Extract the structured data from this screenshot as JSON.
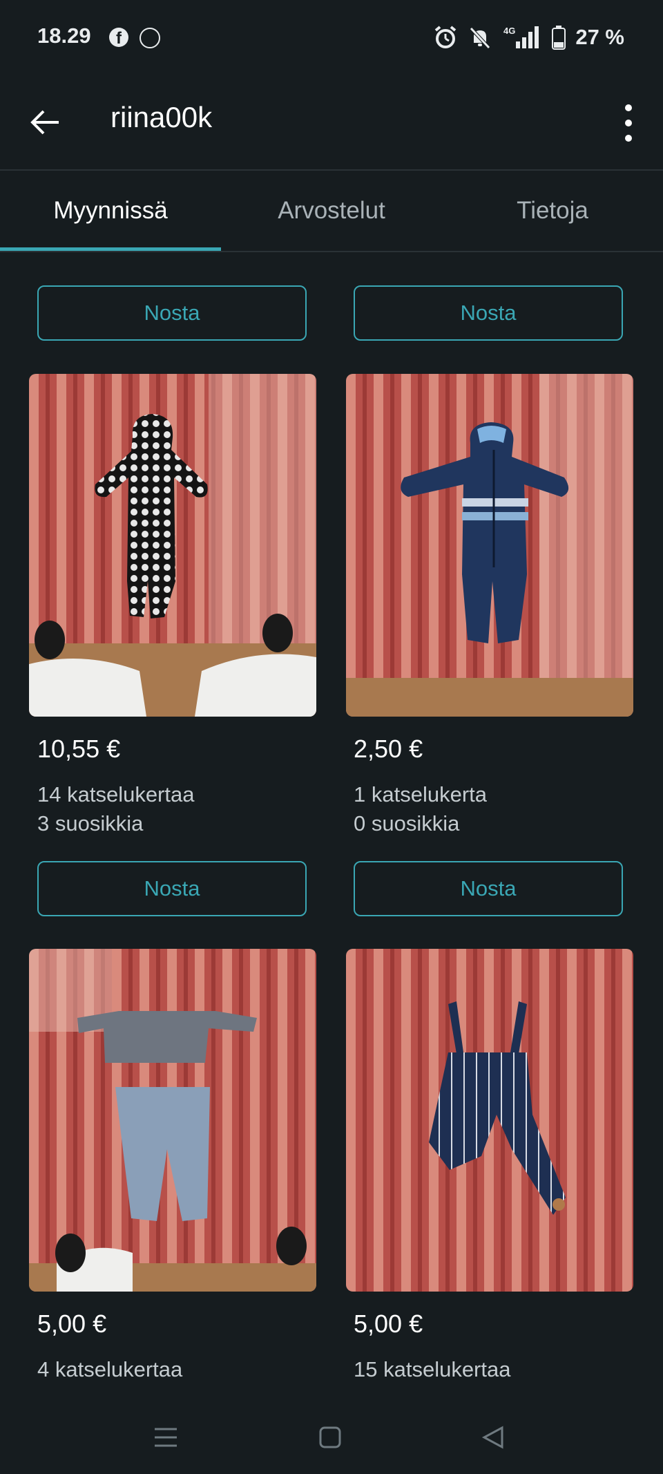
{
  "status_bar": {
    "time": "18.29",
    "icons": [
      "facebook-icon",
      "activity-icon",
      "alarm-icon",
      "notifications-off-icon",
      "signal-4g-icon",
      "battery-icon"
    ],
    "network": "4G",
    "battery": "27 %"
  },
  "app_bar": {
    "title": "riina00k",
    "back_icon": "arrow-left-icon",
    "more_icon": "more-vert-icon"
  },
  "tabs": [
    {
      "label": "Myynnissä",
      "active": true
    },
    {
      "label": "Arvostelut",
      "active": false
    },
    {
      "label": "Tietoja",
      "active": false
    }
  ],
  "items": [
    {
      "bump_label": "Nosta",
      "price": "10,55 €",
      "views": "14 katselukertaa",
      "favorites": "3 suosikkia"
    },
    {
      "bump_label": "Nosta",
      "price": "2,50 €",
      "views": "1 katselukerta",
      "favorites": "0 suosikkia"
    },
    {
      "bump_label": "Nosta",
      "price": "5,00 €",
      "views": "4 katselukertaa",
      "favorites": ""
    },
    {
      "bump_label": "Nosta",
      "price": "5,00 €",
      "views": "15 katselukertaa",
      "favorites": ""
    }
  ],
  "colors": {
    "background": "#161c1f",
    "accent": "#3aa7b4",
    "text_secondary": "#c5ccd0"
  },
  "nav_bar": {
    "icons": [
      "recent-apps-icon",
      "home-icon",
      "back-icon"
    ]
  }
}
